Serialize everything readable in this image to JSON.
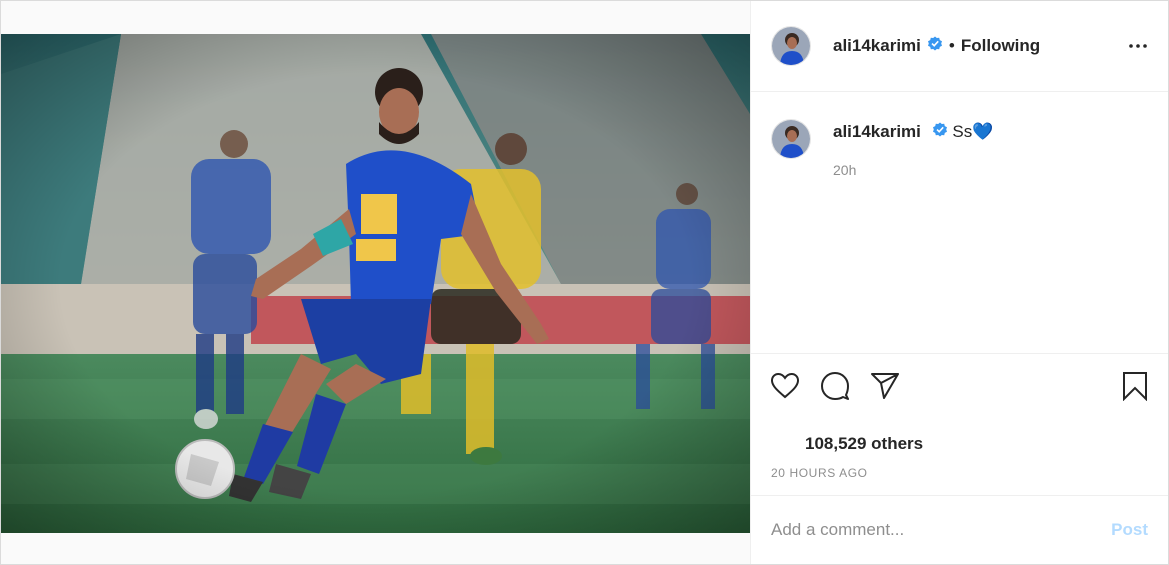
{
  "colors": {
    "verified": "#3897f0",
    "heart_emoji": "#29a3ff",
    "post_button": "#b3dbff",
    "muted": "#8e8e8e"
  },
  "photo": {
    "icon": "soccer-player-photo"
  },
  "header": {
    "username": "ali14karimi",
    "separator": "•",
    "follow_status": "Following",
    "more_icon": "more-horizontal-icon"
  },
  "caption": {
    "username": "ali14karimi",
    "text": "Ss",
    "emoji": "💙",
    "time": "20h"
  },
  "actions": {
    "like_icon": "heart-icon",
    "comment_icon": "comment-icon",
    "share_icon": "share-icon",
    "save_icon": "bookmark-icon"
  },
  "likes_text": "108,529 others",
  "date_text": "20 HOURS AGO",
  "comment_box": {
    "placeholder": "Add a comment...",
    "post_label": "Post"
  }
}
